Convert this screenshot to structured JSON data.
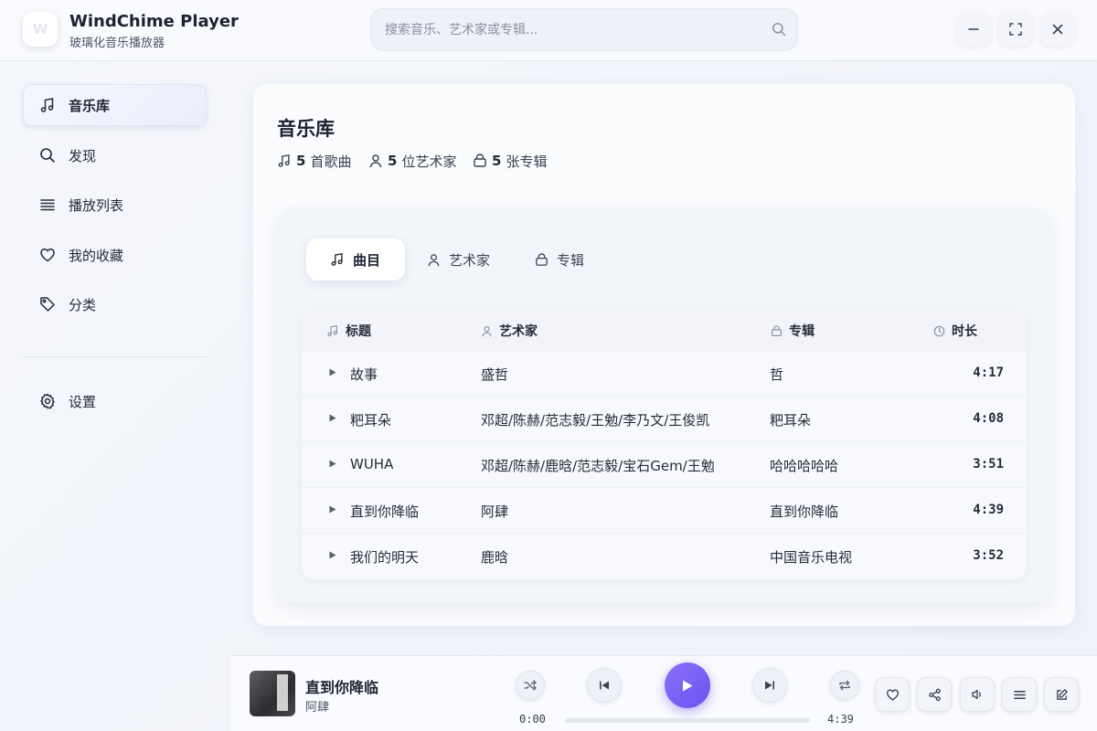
{
  "app": {
    "logo_letter": "W",
    "title": "WindChime Player",
    "subtitle": "玻璃化音乐播放器"
  },
  "search": {
    "placeholder": "搜索音乐、艺术家或专辑...",
    "value": ""
  },
  "window_controls": [
    "minimize-icon",
    "maximize-icon",
    "close-icon"
  ],
  "sidebar": {
    "items": [
      {
        "label": "音乐库",
        "icon": "music-note-icon",
        "active": true
      },
      {
        "label": "发现",
        "icon": "search-icon",
        "active": false
      },
      {
        "label": "播放列表",
        "icon": "list-icon",
        "active": false
      },
      {
        "label": "我的收藏",
        "icon": "heart-icon",
        "active": false
      },
      {
        "label": "分类",
        "icon": "tag-icon",
        "active": false
      }
    ],
    "settings": {
      "label": "设置",
      "icon": "gear-icon"
    }
  },
  "library": {
    "title": "音乐库",
    "stats": [
      {
        "count": "5",
        "label": "首歌曲",
        "icon": "music-note-icon"
      },
      {
        "count": "5",
        "label": "位艺术家",
        "icon": "user-icon"
      },
      {
        "count": "5",
        "label": "张专辑",
        "icon": "album-icon"
      }
    ],
    "tabs": [
      {
        "label": "曲目",
        "icon": "music-note-icon",
        "active": true
      },
      {
        "label": "艺术家",
        "icon": "user-icon",
        "active": false
      },
      {
        "label": "专辑",
        "icon": "album-icon",
        "active": false
      }
    ],
    "columns": {
      "title": "标题",
      "artist": "艺术家",
      "album": "专辑",
      "duration": "时长"
    },
    "tracks": [
      {
        "title": "故事",
        "artist": "盛哲",
        "album": "哲",
        "duration": "4:17"
      },
      {
        "title": "粑耳朵",
        "artist": "邓超/陈赫/范志毅/王勉/李乃文/王俊凯",
        "album": "粑耳朵",
        "duration": "4:08"
      },
      {
        "title": "WUHA",
        "artist": "邓超/陈赫/鹿晗/范志毅/宝石Gem/王勉",
        "album": "哈哈哈哈哈",
        "duration": "3:51"
      },
      {
        "title": "直到你降临",
        "artist": "阿肆",
        "album": "直到你降临",
        "duration": "4:39"
      },
      {
        "title": "我们的明天",
        "artist": "鹿晗",
        "album": "中国音乐电视",
        "duration": "3:52"
      }
    ]
  },
  "player": {
    "track_title": "直到你降临",
    "track_artist": "阿肆",
    "current_time": "0:00",
    "total_time": "4:39",
    "progress": 0,
    "accent_color": "#7a62f4",
    "controls": [
      "shuffle-icon",
      "previous-icon",
      "play-icon",
      "next-icon",
      "repeat-icon"
    ],
    "tools": [
      "heart-icon",
      "share-icon",
      "volume-icon",
      "queue-icon",
      "edit-icon"
    ]
  }
}
